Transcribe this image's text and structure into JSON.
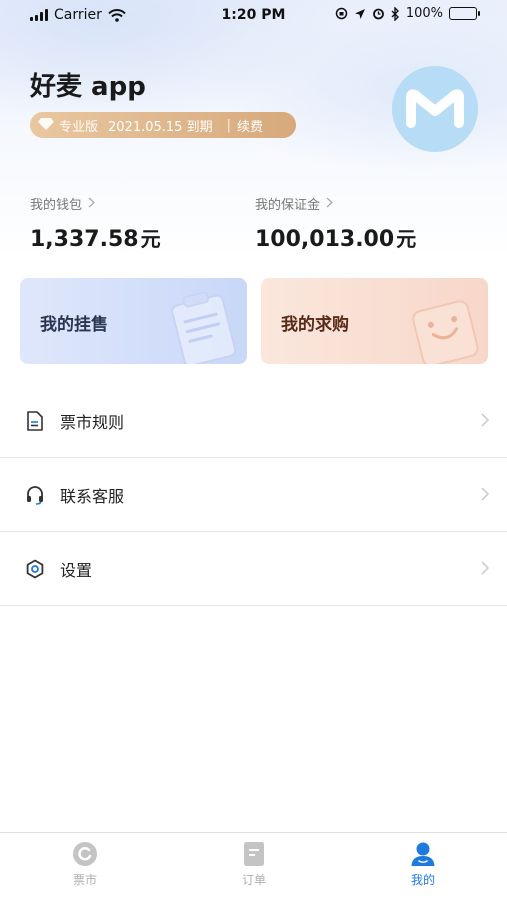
{
  "status_bar": {
    "carrier": "Carrier",
    "time": "1:20 PM",
    "battery": "100%"
  },
  "header": {
    "app_name": "好麦 app",
    "badge": {
      "level": "专业版",
      "expiry": "2021.05.15 到期",
      "renew": "续费"
    }
  },
  "wallet": {
    "label": "我的钱包",
    "amount": "1,337.58",
    "unit": "元"
  },
  "deposit": {
    "label": "我的保证金",
    "amount": "100,013.00",
    "unit": "元"
  },
  "cards": {
    "sell": "我的挂售",
    "buy": "我的求购"
  },
  "menu": [
    {
      "label": "票市规则",
      "icon": "document-icon"
    },
    {
      "label": "联系客服",
      "icon": "headset-icon"
    },
    {
      "label": "设置",
      "icon": "gear-icon"
    }
  ],
  "tabs": [
    {
      "label": "票市",
      "icon": "market-icon",
      "active": false
    },
    {
      "label": "订单",
      "icon": "order-icon",
      "active": false
    },
    {
      "label": "我的",
      "icon": "user-icon",
      "active": true
    }
  ],
  "colors": {
    "accent": "#1f7ae0",
    "badge": "#d7a97c",
    "avatar": "#b7dcf6"
  }
}
